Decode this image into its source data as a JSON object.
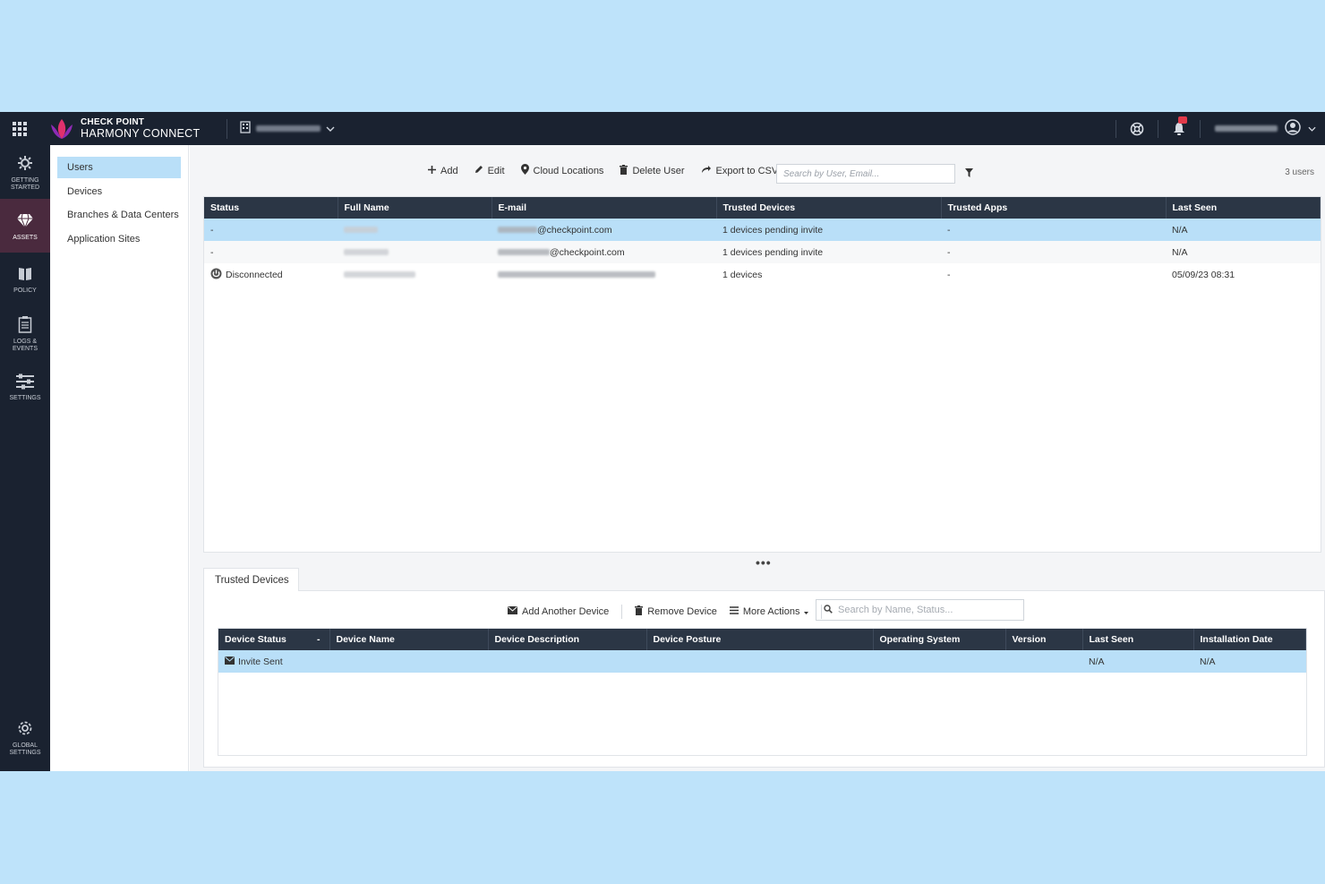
{
  "topbar": {
    "brand_line1": "CHECK POINT",
    "brand_line2": "HARMONY CONNECT",
    "icons": [
      "apps-grid-icon",
      "building-icon",
      "chevron-down-icon",
      "support-icon",
      "bell-icon",
      "user-avatar-icon"
    ]
  },
  "sidebar": {
    "items": [
      {
        "label": "GETTING\nSTARTED",
        "icon": "getting-started-icon"
      },
      {
        "label": "ASSETS",
        "icon": "gem-icon"
      },
      {
        "label": "POLICY",
        "icon": "book-icon"
      },
      {
        "label": "LOGS &\nEVENTS",
        "icon": "clipboard-icon"
      },
      {
        "label": "SETTINGS",
        "icon": "sliders-icon"
      }
    ],
    "global": {
      "label": "GLOBAL\nSETTINGS",
      "icon": "gear-icon"
    }
  },
  "subnav": {
    "items": [
      "Users",
      "Devices",
      "Branches & Data Centers",
      "Application Sites"
    ]
  },
  "toolbar": {
    "add": "Add",
    "edit": "Edit",
    "cloud_locations": "Cloud Locations",
    "delete_user": "Delete User",
    "export_csv": "Export to CSV",
    "search_placeholder": "Search by User, Email...",
    "count": "3 users"
  },
  "users_table": {
    "columns": [
      "Status",
      "Full Name",
      "E-mail",
      "Trusted Devices",
      "Trusted Apps",
      "Last Seen"
    ],
    "rows": [
      {
        "status": "-",
        "email_suffix": "@checkpoint.com",
        "trusted_devices": "1 devices pending invite",
        "trusted_apps": "-",
        "last_seen": "N/A"
      },
      {
        "status": "-",
        "email_suffix": "@checkpoint.com",
        "trusted_devices": "1 devices pending invite",
        "trusted_apps": "-",
        "last_seen": "N/A"
      },
      {
        "status": "Disconnected",
        "email_suffix": "",
        "trusted_devices": "1 devices",
        "trusted_apps": "-",
        "last_seen": "05/09/23 08:31"
      }
    ]
  },
  "splitter": "•••",
  "trusted_devices": {
    "tab_label": "Trusted Devices",
    "add_device": "Add Another Device",
    "remove_device": "Remove Device",
    "more_actions": "More Actions",
    "search_placeholder": "Search by Name, Status...",
    "columns": [
      "Device Status",
      "Device Name",
      "Device Description",
      "Device Posture",
      "Operating System",
      "Version",
      "Last Seen",
      "Installation Date"
    ],
    "sort_indicator": "-",
    "rows": [
      {
        "status": "Invite Sent",
        "last_seen": "N/A",
        "installation_date": "N/A"
      }
    ]
  },
  "colors": {
    "topbar": "#1a2230",
    "selected_row": "#b9dff8",
    "table_header": "#2b3645",
    "brand_accent": "#e0316d"
  }
}
